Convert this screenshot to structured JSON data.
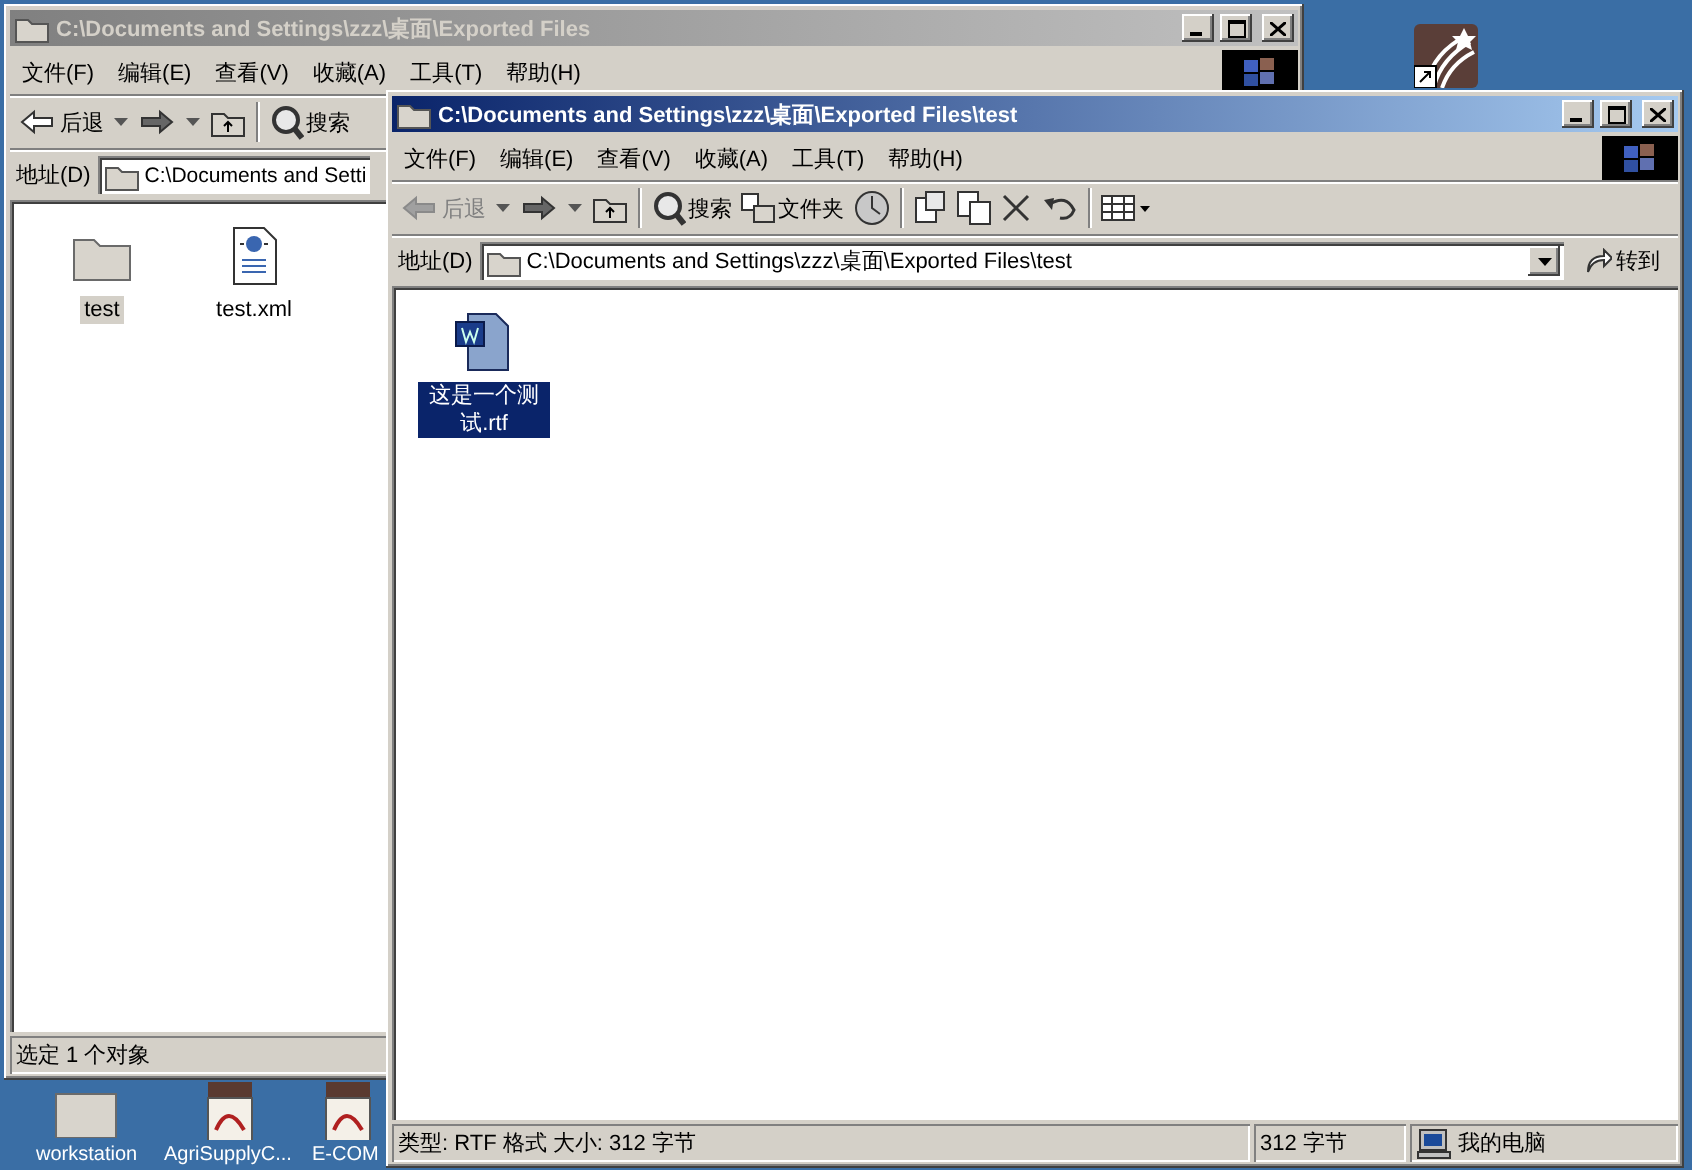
{
  "desktop_icons": [
    {
      "label": "workstation",
      "kind": "folder"
    },
    {
      "label": "AgriSupplyC...",
      "kind": "pdf"
    },
    {
      "label": "E-COM",
      "kind": "pdf"
    }
  ],
  "windows": [
    {
      "active": false,
      "title": "C:\\Documents and Settings\\zzz\\桌面\\Exported Files",
      "menu": [
        "文件(F)",
        "编辑(E)",
        "查看(V)",
        "收藏(A)",
        "工具(T)",
        "帮助(H)"
      ],
      "toolbar": [
        {
          "kind": "back",
          "label": "后退",
          "disabled": false
        },
        {
          "kind": "forward",
          "disabled": false
        },
        {
          "kind": "up"
        },
        {
          "kind": "separator"
        },
        {
          "kind": "search",
          "label": "搜索"
        }
      ],
      "address": {
        "label": "地址(D)",
        "value": "C:\\Documents and Setti"
      },
      "files": [
        {
          "name": "test",
          "kind": "folder",
          "selected": true
        },
        {
          "name": "test.xml",
          "kind": "xml",
          "selected": false
        }
      ],
      "status": [
        {
          "kind": "text",
          "text": "选定 1 个对象"
        }
      ]
    },
    {
      "active": true,
      "title": "C:\\Documents and Settings\\zzz\\桌面\\Exported Files\\test",
      "menu": [
        "文件(F)",
        "编辑(E)",
        "查看(V)",
        "收藏(A)",
        "工具(T)",
        "帮助(H)"
      ],
      "toolbar": [
        {
          "kind": "back",
          "label": "后退",
          "disabled": true
        },
        {
          "kind": "forward",
          "disabled": false
        },
        {
          "kind": "up"
        },
        {
          "kind": "separator"
        },
        {
          "kind": "search",
          "label": "搜索"
        },
        {
          "kind": "folders",
          "label": "文件夹"
        },
        {
          "kind": "history"
        },
        {
          "kind": "separator"
        },
        {
          "kind": "move"
        },
        {
          "kind": "copy"
        },
        {
          "kind": "delete"
        },
        {
          "kind": "undo"
        },
        {
          "kind": "separator"
        },
        {
          "kind": "views"
        }
      ],
      "address": {
        "label": "地址(D)",
        "value": "C:\\Documents and Settings\\zzz\\桌面\\Exported Files\\test",
        "go": "转到"
      },
      "files": [
        {
          "name": "这是一个测试.rtf",
          "kind": "rtf",
          "selected": true
        }
      ],
      "status": [
        {
          "kind": "text",
          "text": "类型: RTF 格式 大小: 312 字节"
        },
        {
          "kind": "size",
          "text": "312 字节"
        },
        {
          "kind": "computer",
          "text": "我的电脑"
        }
      ]
    }
  ]
}
